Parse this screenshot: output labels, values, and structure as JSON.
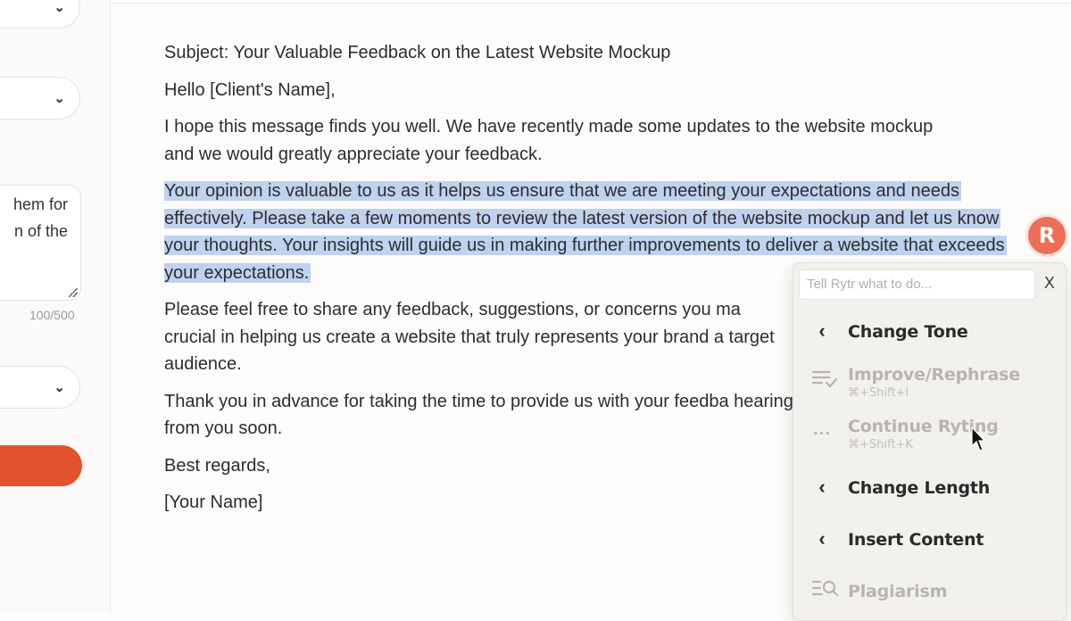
{
  "sidebar": {
    "textarea_value": "hem for\nn of the",
    "char_counter": "100/500"
  },
  "email": {
    "subject": "Subject: Your Valuable Feedback on the Latest Website Mockup",
    "greeting": "Hello [Client's Name],",
    "para1": "I hope this message finds you well. We have recently made some updates to the website mockup and we would greatly appreciate your feedback.",
    "para2_selected": "Your opinion is valuable to us as it helps us ensure that we are meeting your expectations and needs effectively. Please take a few moments to review the latest version of the website mockup and let us know your thoughts. Your insights will guide us in making further improvements to deliver a website that exceeds your expectations.",
    "para3": "Please feel free to share any feedback, suggestions, or concerns you ma crucial in helping us create a website that truly represents your brand a target audience.",
    "para4": "Thank you in advance for taking the time to provide us with your feedba hearing from you soon.",
    "closing": "Best regards,",
    "signature": "[Your Name]"
  },
  "rytr": {
    "badge_letter": "R",
    "command_placeholder": "Tell Rytr what to do...",
    "close_label": "X",
    "menu": [
      {
        "label": "Change Tone",
        "icon": "chevron-left-icon",
        "enabled": true
      },
      {
        "label": "Improve/Rephrase",
        "shortcut": "⌘+Shift+I",
        "icon": "rephrase-icon",
        "enabled": false
      },
      {
        "label": "Continue Ryting",
        "shortcut": "⌘+Shift+K",
        "icon": "ellipsis-icon",
        "enabled": false
      },
      {
        "label": "Change Length",
        "icon": "chevron-left-icon",
        "enabled": true
      },
      {
        "label": "Insert Content",
        "icon": "chevron-left-icon",
        "enabled": true
      },
      {
        "label": "Plagiarism",
        "icon": "plagiarism-icon",
        "enabled": false
      }
    ]
  },
  "colors": {
    "accent": "#e2542e",
    "selection": "#bfd2ef",
    "rytr_badge": "#ec6e58"
  }
}
